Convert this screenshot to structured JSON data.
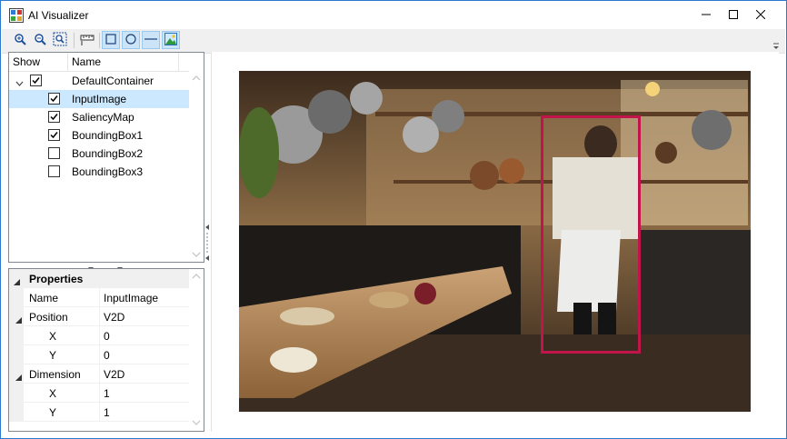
{
  "window": {
    "title": "AI Visualizer",
    "app_icon": "chart-app-icon",
    "controls": [
      "minimize-icon",
      "maximize-icon",
      "close-icon"
    ]
  },
  "toolbar": {
    "buttons": [
      {
        "name": "zoom-in-icon",
        "checked": false
      },
      {
        "name": "zoom-out-icon",
        "checked": false
      },
      {
        "name": "zoom-fit-icon",
        "checked": false
      },
      {
        "name": "ruler-icon",
        "checked": false
      },
      {
        "name": "rectangle-tool-icon",
        "checked": true
      },
      {
        "name": "ellipse-tool-icon",
        "checked": true
      },
      {
        "name": "line-tool-icon",
        "checked": true
      },
      {
        "name": "image-tool-icon",
        "checked": true
      }
    ],
    "overflow_icon": "chevron-down-icon"
  },
  "tree": {
    "columns": {
      "show": "Show",
      "name": "Name"
    },
    "root": {
      "label": "DefaultContainer",
      "checked": true,
      "expanded": true
    },
    "items": [
      {
        "label": "InputImage",
        "checked": true,
        "selected": true
      },
      {
        "label": "SaliencyMap",
        "checked": true,
        "selected": false
      },
      {
        "label": "BoundingBox1",
        "checked": true,
        "selected": false
      },
      {
        "label": "BoundingBox2",
        "checked": false,
        "selected": false
      },
      {
        "label": "BoundingBox3",
        "checked": false,
        "selected": false
      }
    ]
  },
  "properties": {
    "category": "Properties",
    "rows": [
      {
        "name": "Name",
        "value": "InputImage",
        "level": 1
      },
      {
        "name": "Position",
        "value": "V2D",
        "level": 0,
        "expanded": true
      },
      {
        "name": "X",
        "value": "0",
        "level": 2
      },
      {
        "name": "Y",
        "value": "0",
        "level": 2
      },
      {
        "name": "Dimension",
        "value": "V2D",
        "level": 0,
        "expanded": true
      },
      {
        "name": "X",
        "value": "1",
        "level": 2
      },
      {
        "name": "Y",
        "value": "1",
        "level": 2
      }
    ]
  },
  "colors": {
    "bbox": "#c0144b",
    "selection": "#cce8ff",
    "checked_tool": "#cce4f7"
  }
}
